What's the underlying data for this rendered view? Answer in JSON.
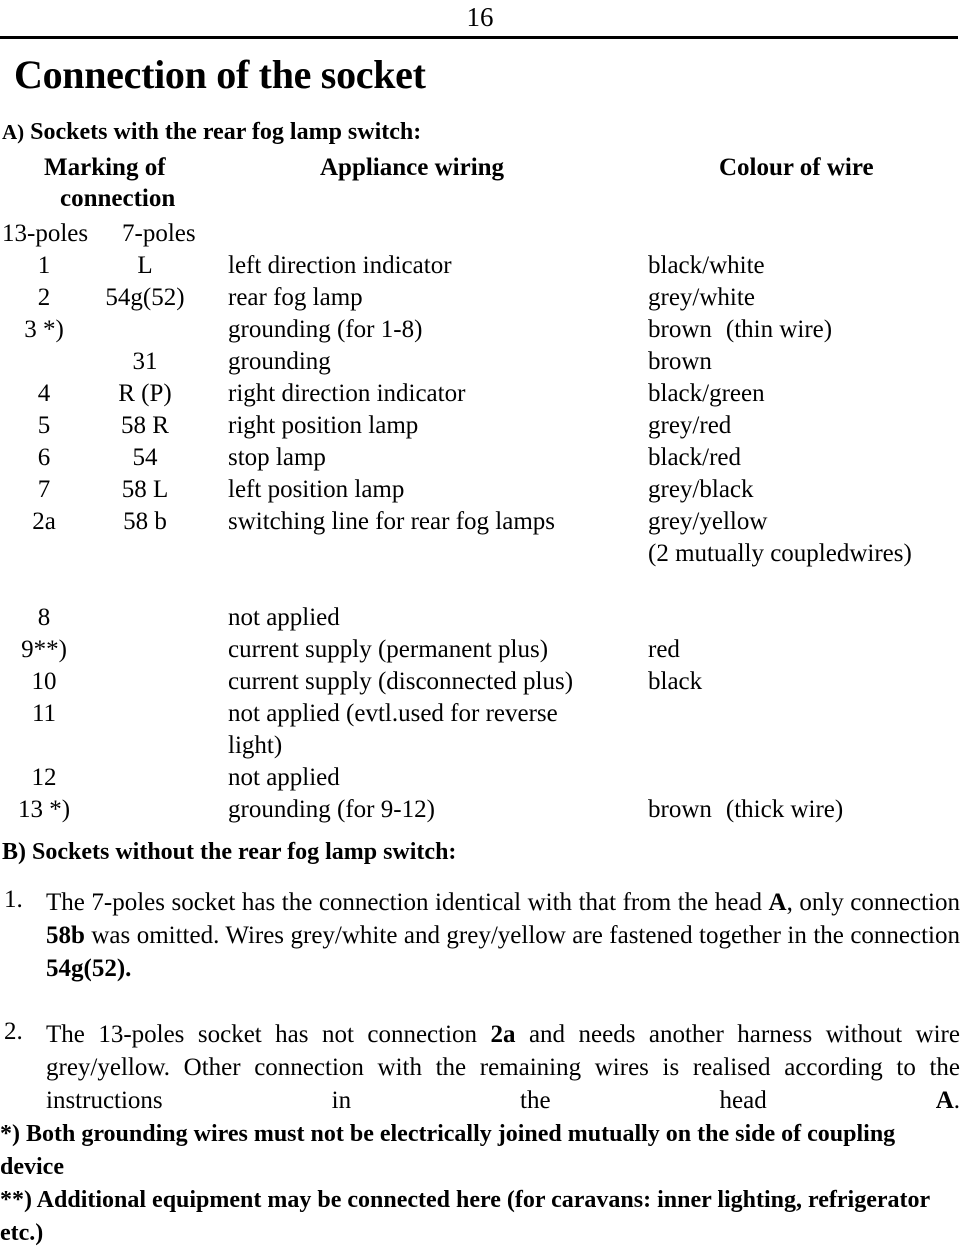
{
  "page": {
    "number": "16",
    "title": "Connection of the socket"
  },
  "section_a": {
    "heading_marker": "A)",
    "heading_text": " Sockets with the rear fog lamp switch:",
    "columns": {
      "marking_line1": "Marking of",
      "marking_line2": "connection",
      "appliance": "Appliance wiring",
      "colour": "Colour of wire",
      "sub_13": "13-poles",
      "sub_7": "7-poles"
    },
    "rows": [
      {
        "poles13": "1",
        "poles7": "L",
        "desc": "left direction indicator",
        "colour": "black/white",
        "colour_note": "",
        "colour_sub": ""
      },
      {
        "poles13": "2",
        "poles7": "54g(52)",
        "desc": "rear fog lamp",
        "colour": "grey/white",
        "colour_note": "",
        "colour_sub": ""
      },
      {
        "poles13": "3 *)",
        "poles7": "",
        "desc": "grounding (for 1-8)",
        "colour": "brown",
        "colour_note": "(thin wire)",
        "colour_sub": ""
      },
      {
        "poles13": "",
        "poles7": "31",
        "desc": "grounding",
        "colour": "brown",
        "colour_note": "",
        "colour_sub": ""
      },
      {
        "poles13": "4",
        "poles7": "R (P)",
        "desc": "right direction indicator",
        "colour": "black/green",
        "colour_note": "",
        "colour_sub": ""
      },
      {
        "poles13": "5",
        "poles7": "58 R",
        "desc": "right position lamp",
        "colour": "grey/red",
        "colour_note": "",
        "colour_sub": ""
      },
      {
        "poles13": "6",
        "poles7": "54",
        "desc": "stop lamp",
        "colour": "black/red",
        "colour_note": "",
        "colour_sub": ""
      },
      {
        "poles13": "7",
        "poles7": "58 L",
        "desc": "left position lamp",
        "colour": "grey/black",
        "colour_note": "",
        "colour_sub": ""
      },
      {
        "poles13": "2a",
        "poles7": "58 b",
        "desc": "switching line for rear fog lamps",
        "colour": "grey/yellow",
        "colour_note": "",
        "colour_sub": "(2 mutually coupledwires)"
      },
      {
        "poles13": "8",
        "poles7": "",
        "desc": "not applied",
        "colour": "",
        "colour_note": "",
        "colour_sub": ""
      },
      {
        "poles13": "9**)",
        "poles7": "",
        "desc": "current supply (permanent plus)",
        "colour": "red",
        "colour_note": "",
        "colour_sub": ""
      },
      {
        "poles13": "10",
        "poles7": "",
        "desc": "current supply (disconnected plus)",
        "colour": "black",
        "colour_note": "",
        "colour_sub": ""
      },
      {
        "poles13": "11",
        "poles7": "",
        "desc": "not applied (evtl.used for reverse",
        "desc2": "light)",
        "colour": "",
        "colour_note": "",
        "colour_sub": ""
      },
      {
        "poles13": "12",
        "poles7": "",
        "desc": "not applied",
        "colour": "",
        "colour_note": "",
        "colour_sub": ""
      },
      {
        "poles13": "13 *)",
        "poles7": "",
        "desc": "grounding (for 9-12)",
        "colour": "brown",
        "colour_note": "(thick wire)",
        "colour_sub": ""
      }
    ]
  },
  "section_b": {
    "heading": "B) Sockets without the rear fog lamp switch:",
    "items": [
      {
        "number": "1.",
        "part1": "The 7-poles socket has the connection identical with that from the head ",
        "bold1": "A",
        "part2": ", only connection ",
        "bold2": "58b",
        "part3": " was omitted. Wires grey/white and grey/yellow are fastened together in the connection ",
        "bold3": "54g(52)."
      },
      {
        "number": "2.",
        "part1": "The 13-poles socket has not connection ",
        "bold1": "2a",
        "part2": " and needs another harness without wire grey/yellow. Other connection with the remaining wires is realised according to the instructions in the head ",
        "bold2": "A",
        "part3": ".",
        "bold3": ""
      }
    ]
  },
  "footnotes": [
    "*) Both grounding wires must not be electrically joined  mutually on the side of coupling device",
    "**) Additional equipment may be connected here (for caravans: inner lighting, refrigerator etc.)"
  ]
}
